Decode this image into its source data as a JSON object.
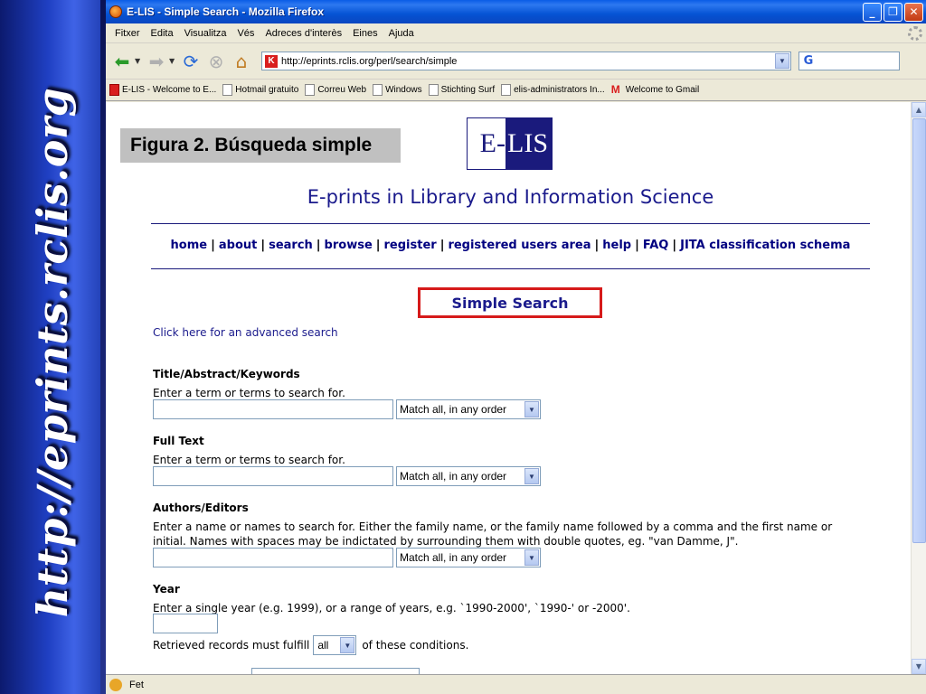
{
  "slide": {
    "vertical_url": "http://eprints.rclis.org",
    "figure_label": "Figura 2. Búsqueda simple"
  },
  "browser": {
    "window_title": "E-LIS - Simple Search - Mozilla Firefox",
    "menu": [
      "Fitxer",
      "Edita",
      "Visualitza",
      "Vés",
      "Adreces d'interès",
      "Eines",
      "Ajuda"
    ],
    "url": "http://eprints.rclis.org/perl/search/simple",
    "search_engine_glyph": "G",
    "bookmarks": [
      {
        "label": "E-LIS - Welcome to E...",
        "icon": "elis-favicon"
      },
      {
        "label": "Hotmail gratuito",
        "icon": "page-icon"
      },
      {
        "label": "Correu Web",
        "icon": "page-icon"
      },
      {
        "label": "Windows",
        "icon": "page-icon"
      },
      {
        "label": "Stichting Surf",
        "icon": "page-icon"
      },
      {
        "label": "elis-administrators In...",
        "icon": "page-icon"
      },
      {
        "label": "Welcome to Gmail",
        "icon": "gmail-icon"
      }
    ],
    "status_text": "Fet"
  },
  "page": {
    "logo_left": "E-",
    "logo_right": "LIS",
    "site_title": "E-prints in Library and Information Science",
    "nav_links": [
      "home",
      "about",
      "search",
      "browse",
      "register",
      "registered users area",
      "help",
      "FAQ",
      "JITA classification schema"
    ],
    "heading": "Simple Search",
    "advanced_link": "Click here for an advanced search",
    "fields": [
      {
        "label": "Title/Abstract/Keywords",
        "help": "Enter a term or terms to search for.",
        "match": "Match all, in any order"
      },
      {
        "label": "Full Text",
        "help": "Enter a term or terms to search for.",
        "match": "Match all, in any order"
      },
      {
        "label": "Authors/Editors",
        "help": "Enter a name or names to search for. Either the family name, or the family name followed by a comma and the first name or initial. Names with spaces may be indictated by surrounding them with double quotes, eg. \"van Damme, J\".",
        "match": "Match all, in any order"
      }
    ],
    "year": {
      "label": "Year",
      "help": "Enter a single year (e.g. 1999), or a range of years, e.g. `1990-2000', `1990-' or -2000'."
    },
    "conditions": {
      "prefix": "Retrieved records must fulfill",
      "value": "all",
      "suffix": "of these conditions."
    }
  }
}
